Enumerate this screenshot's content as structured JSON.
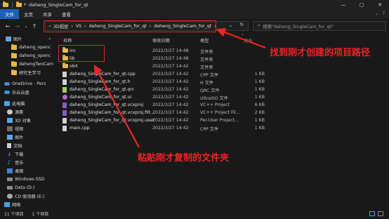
{
  "window": {
    "title": "daheng_SingleCam_for_qt",
    "controls": [
      "—",
      "▢",
      "✕"
    ]
  },
  "ribbon": {
    "tabs": [
      "文件",
      "主页",
      "共享",
      "查看"
    ],
    "active_tab": 0,
    "right_icons": [
      "⌄",
      "?"
    ]
  },
  "nav": {
    "back": "←",
    "forward": "→",
    "recent": "⌄",
    "up": "↑"
  },
  "address": {
    "crumbs": [
      "3D视觉",
      "VS",
      "daheng_SingleCam_for_qt",
      "daheng_SingleCam_for_qt"
    ],
    "separator": "›",
    "dropdown": "⌄",
    "refresh": "↻"
  },
  "search": {
    "placeholder": "搜索\"daheng_SingleCam_for_qt\""
  },
  "sidebar": {
    "items": [
      {
        "label": "图片",
        "icon": "pictures-icon",
        "pinned": true
      },
      {
        "label": "daheng_openc",
        "icon": "folder-icon"
      },
      {
        "label": "daheng_openc",
        "icon": "folder-icon"
      },
      {
        "label": "dahengTwoCam",
        "icon": "folder-icon"
      },
      {
        "label": "研究生学习",
        "icon": "folder-icon"
      },
      {
        "label": "OneDrive - Pers",
        "icon": "cloud-icon"
      },
      {
        "label": "乐云云盘",
        "icon": "cloud-icon"
      },
      {
        "label": "此电脑",
        "icon": "computer-icon"
      },
      {
        "label": "源素",
        "icon": "folder-icon"
      },
      {
        "label": "3D 对象",
        "icon": "cube-icon"
      },
      {
        "label": "视频",
        "icon": "video-icon"
      },
      {
        "label": "图片",
        "icon": "pictures-icon"
      },
      {
        "label": "文档",
        "icon": "document-icon"
      },
      {
        "label": "下载",
        "icon": "download-icon"
      },
      {
        "label": "音乐",
        "icon": "music-icon"
      },
      {
        "label": "桌面",
        "icon": "desktop-icon"
      },
      {
        "label": "Windows-SSD",
        "icon": "drive-icon"
      },
      {
        "label": "Data (D:)",
        "icon": "drive-icon"
      },
      {
        "label": "CD 驱动器 (E:)",
        "icon": "cd-icon"
      },
      {
        "label": "网络",
        "icon": "network-icon"
      }
    ]
  },
  "columns": {
    "name": "名称",
    "date": "修改日期",
    "type": "类型",
    "size": "大小",
    "sort_caret": "⌃"
  },
  "files": [
    {
      "name": "inc",
      "date": "2022/3/27 14:48",
      "type": "文件夹",
      "size": "",
      "icon": "folder-icon"
    },
    {
      "name": "lib",
      "date": "2022/3/27 14:48",
      "type": "文件夹",
      "size": "",
      "icon": "folder-icon"
    },
    {
      "name": "x64",
      "date": "2022/3/27 14:42",
      "type": "文件夹",
      "size": "",
      "icon": "folder-icon"
    },
    {
      "name": "daheng_SingleCam_for_qt.cpp",
      "date": "2022/3/27 14:42",
      "type": "CPP 文件",
      "size": "1 KB",
      "icon": "cpp-file-icon"
    },
    {
      "name": "daheng_SingleCam_for_qt.h",
      "date": "2022/3/27 14:42",
      "type": "H 文件",
      "size": "1 KB",
      "icon": "header-file-icon"
    },
    {
      "name": "daheng_SingleCam_for_qt.qrc",
      "date": "2022/3/27 14:42",
      "type": "QRC 文件",
      "size": "1 KB",
      "icon": "qrc-file-icon"
    },
    {
      "name": "daheng_SingleCam_for_qt.ui",
      "date": "2022/3/27 14:42",
      "type": "UltraISO 文件",
      "size": "1 KB",
      "icon": "ui-file-icon"
    },
    {
      "name": "daheng_SingleCam_for_qt.vcxproj",
      "date": "2022/3/27 14:42",
      "type": "VC++ Project",
      "size": "6 KB",
      "icon": "vcxproj-icon"
    },
    {
      "name": "daheng_SingleCam_for_qt.vcxproj.filt...",
      "date": "2022/3/27 14:42",
      "type": "VC++ Project Fil...",
      "size": "2 KB",
      "icon": "vcxproj-filters-icon"
    },
    {
      "name": "daheng_SingleCam_for_qt.vcxproj.user",
      "date": "2022/3/27 14:42",
      "type": "Per-User Project...",
      "size": "1 KB",
      "icon": "vcxproj-user-icon"
    },
    {
      "name": "main.cpp",
      "date": "2022/3/27 14:42",
      "type": "CPP 文件",
      "size": "1 KB",
      "icon": "cpp-file-icon"
    }
  ],
  "status": {
    "count": "11 个项目",
    "selected": "1 个项目"
  },
  "annotations": {
    "path": "找到刚才创建的项目路径",
    "paste": "粘贴刚才复制的文件夹"
  },
  "colors": {
    "annotation": "#ef2424",
    "accent_tab": "#1b61b8",
    "folder": "#e8b84a",
    "background": "#191919"
  }
}
